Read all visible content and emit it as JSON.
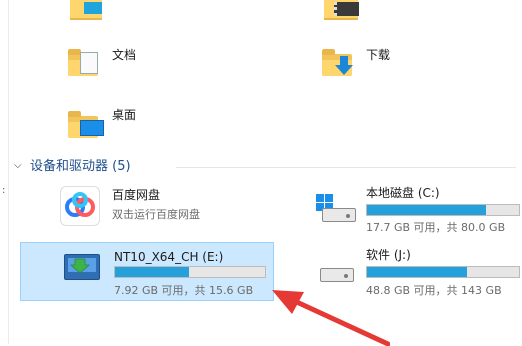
{
  "colors": {
    "selection_bg": "#cce8ff",
    "selection_border": "#99d1ff",
    "bar_fill": "#26a0da",
    "bar_bg": "#e6e6e6",
    "section_header": "#1f4f8f",
    "annotation_arrow": "#e53935"
  },
  "folders": [
    {
      "name": "",
      "icon": "folder-icon"
    },
    {
      "name": "",
      "icon": "video-folder-icon"
    },
    {
      "name": "文档",
      "icon": "documents-folder-icon"
    },
    {
      "name": "下载",
      "icon": "downloads-folder-icon"
    },
    {
      "name": "桌面",
      "icon": "desktop-folder-icon"
    }
  ],
  "devices_section": {
    "title": "设备和驱动器 (5)"
  },
  "devices": {
    "baidu": {
      "name": "百度网盘",
      "subtitle": "双击运行百度网盘",
      "icon": "baidu-netdisk-icon"
    },
    "c_drive": {
      "name": "本地磁盘 (C:)",
      "space": "17.7 GB 可用，共 80.0 GB",
      "used_fraction": 0.78,
      "icon": "windows-drive-icon"
    },
    "e_drive": {
      "name": "NT10_X64_CH (E:)",
      "space": "7.92 GB 可用，共 15.6 GB",
      "used_fraction": 0.49,
      "icon": "dvd-drive-icon",
      "selected": true
    },
    "j_drive": {
      "name": "软件 (J:)",
      "space": "48.8 GB 可用，共 143 GB",
      "used_fraction": 0.66,
      "icon": "hard-drive-icon"
    }
  }
}
